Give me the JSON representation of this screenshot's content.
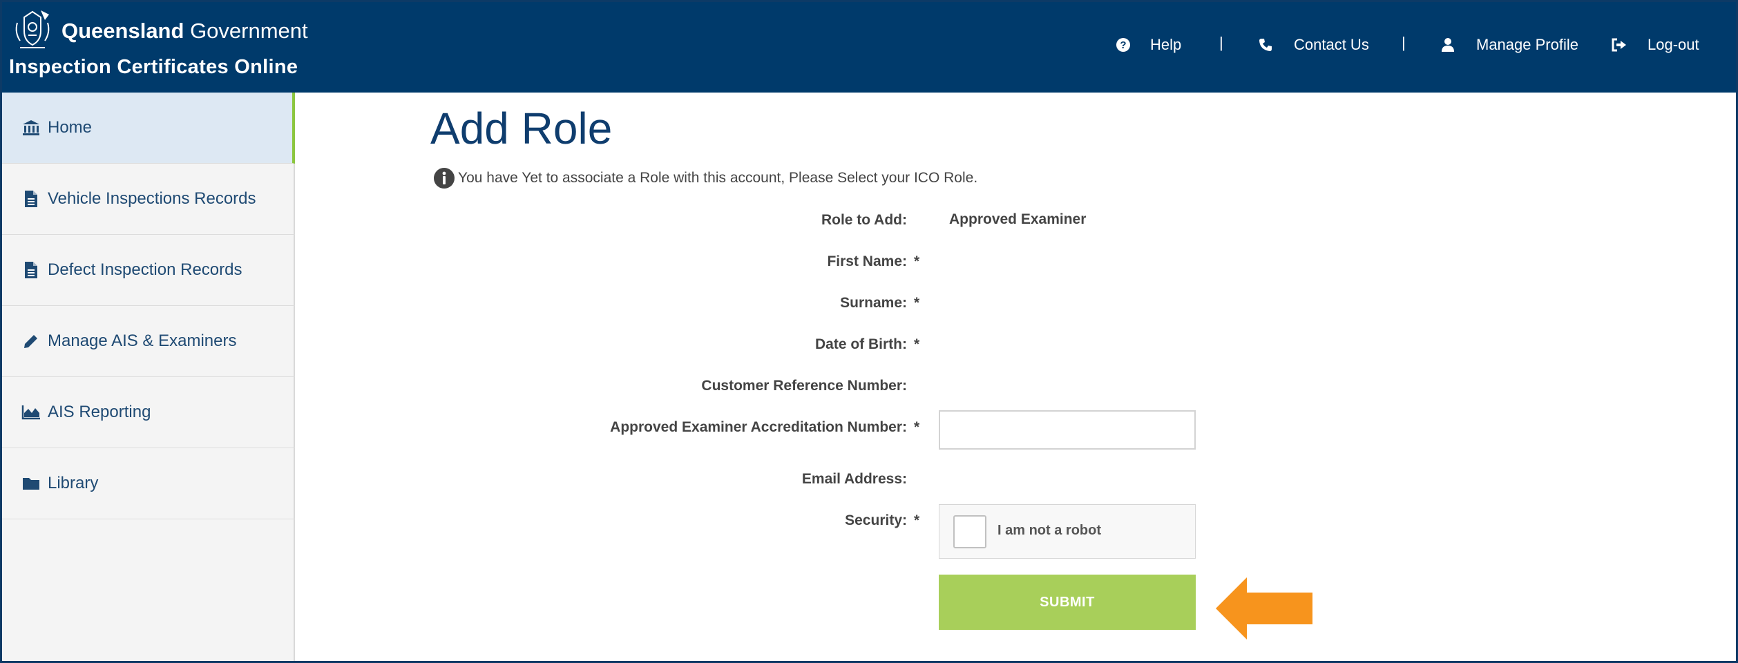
{
  "header": {
    "brand_bold": "Queensland",
    "brand_light": "Government",
    "app_title": "Inspection Certificates Online",
    "nav": {
      "help": "Help",
      "contact": "Contact Us",
      "manage_profile": "Manage Profile",
      "logout": "Log-out",
      "separator": "|"
    }
  },
  "sidebar": {
    "items": [
      {
        "label": "Home",
        "icon": "bank-icon"
      },
      {
        "label": "Vehicle Inspections Records",
        "icon": "document-icon"
      },
      {
        "label": "Defect Inspection Records",
        "icon": "document-icon"
      },
      {
        "label": "Manage AIS & Examiners",
        "icon": "pencil-icon"
      },
      {
        "label": "AIS Reporting",
        "icon": "area-chart-icon"
      },
      {
        "label": "Library",
        "icon": "folder-icon"
      }
    ]
  },
  "main": {
    "title": "Add Role",
    "info": "You have Yet to associate a Role with this account, Please Select your ICO Role.",
    "form": {
      "role_label": "Role to Add:",
      "role_value": "Approved Examiner",
      "first_name_label": "First Name:",
      "surname_label": "Surname:",
      "dob_label": "Date of Birth:",
      "crn_label": "Customer Reference Number:",
      "accreditation_label": "Approved Examiner Accreditation Number:",
      "accreditation_value": "",
      "email_label": "Email Address:",
      "security_label": "Security:",
      "required_marker": "*",
      "captcha_text": "I am not a robot",
      "submit_label": "SUBMIT"
    }
  },
  "colors": {
    "header_bg": "#003a6b",
    "submit_bg": "#a8cf5a",
    "active_border": "#8cc63f",
    "arrow": "#f7941d"
  }
}
